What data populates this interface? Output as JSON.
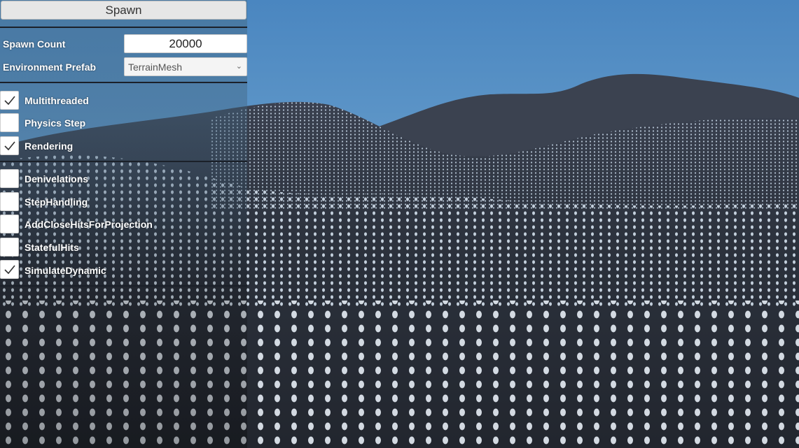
{
  "spawn_button": {
    "label": "Spawn"
  },
  "spawn_count": {
    "label": "Spawn Count",
    "value": "20000"
  },
  "environment_prefab": {
    "label": "Environment Prefab",
    "selected": "TerrainMesh"
  },
  "toggles_group_1": [
    {
      "label": "Multithreaded",
      "checked": true
    },
    {
      "label": "Physics Step",
      "checked": false
    },
    {
      "label": "Rendering",
      "checked": true
    }
  ],
  "toggles_group_2": [
    {
      "label": "Denivelations",
      "checked": false
    },
    {
      "label": "StepHandling",
      "checked": false
    },
    {
      "label": "AddCloseHitsForProjection",
      "checked": false
    },
    {
      "label": "StatefulHits",
      "checked": false
    },
    {
      "label": "SimulateDynamic",
      "checked": true
    }
  ],
  "icons": {
    "checkmark": "check-icon",
    "dropdown": "chevron-down-icon"
  },
  "colors": {
    "sky_top": "#4f8fc7",
    "sky_bottom": "#8ab8d8",
    "terrain": "#2b3039",
    "panel_text": "#ffffff"
  }
}
